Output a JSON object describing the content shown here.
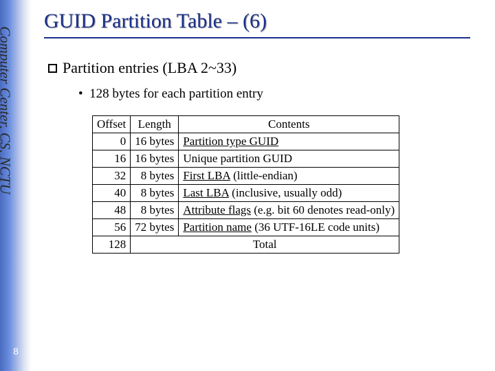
{
  "side_label": "Computer Center, CS, NCTU",
  "page_number": "8",
  "title": "GUID Partition Table – (6)",
  "bullet1": "Partition entries (LBA 2~33)",
  "bullet2": "128 bytes for each partition entry",
  "table": {
    "headers": {
      "offset": "Offset",
      "length": "Length",
      "contents": "Contents"
    },
    "rows": [
      {
        "offset": "0",
        "length": "16 bytes",
        "contents_u": "Partition type GUID",
        "contents_rest": ""
      },
      {
        "offset": "16",
        "length": "16 bytes",
        "contents_u": "",
        "contents_rest": "Unique partition GUID"
      },
      {
        "offset": "32",
        "length": "8 bytes",
        "contents_u": "First LBA",
        "contents_rest": " (little-endian)"
      },
      {
        "offset": "40",
        "length": "8 bytes",
        "contents_u": "Last LBA",
        "contents_rest": " (inclusive, usually odd)"
      },
      {
        "offset": "48",
        "length": "8 bytes",
        "contents_u": "Attribute flags",
        "contents_rest": " (e.g. bit 60 denotes read-only)"
      },
      {
        "offset": "56",
        "length": "72 bytes",
        "contents_u": "Partition name",
        "contents_rest": " (36 UTF-16LE code units)"
      }
    ],
    "total_offset": "128",
    "total_label": "Total"
  }
}
